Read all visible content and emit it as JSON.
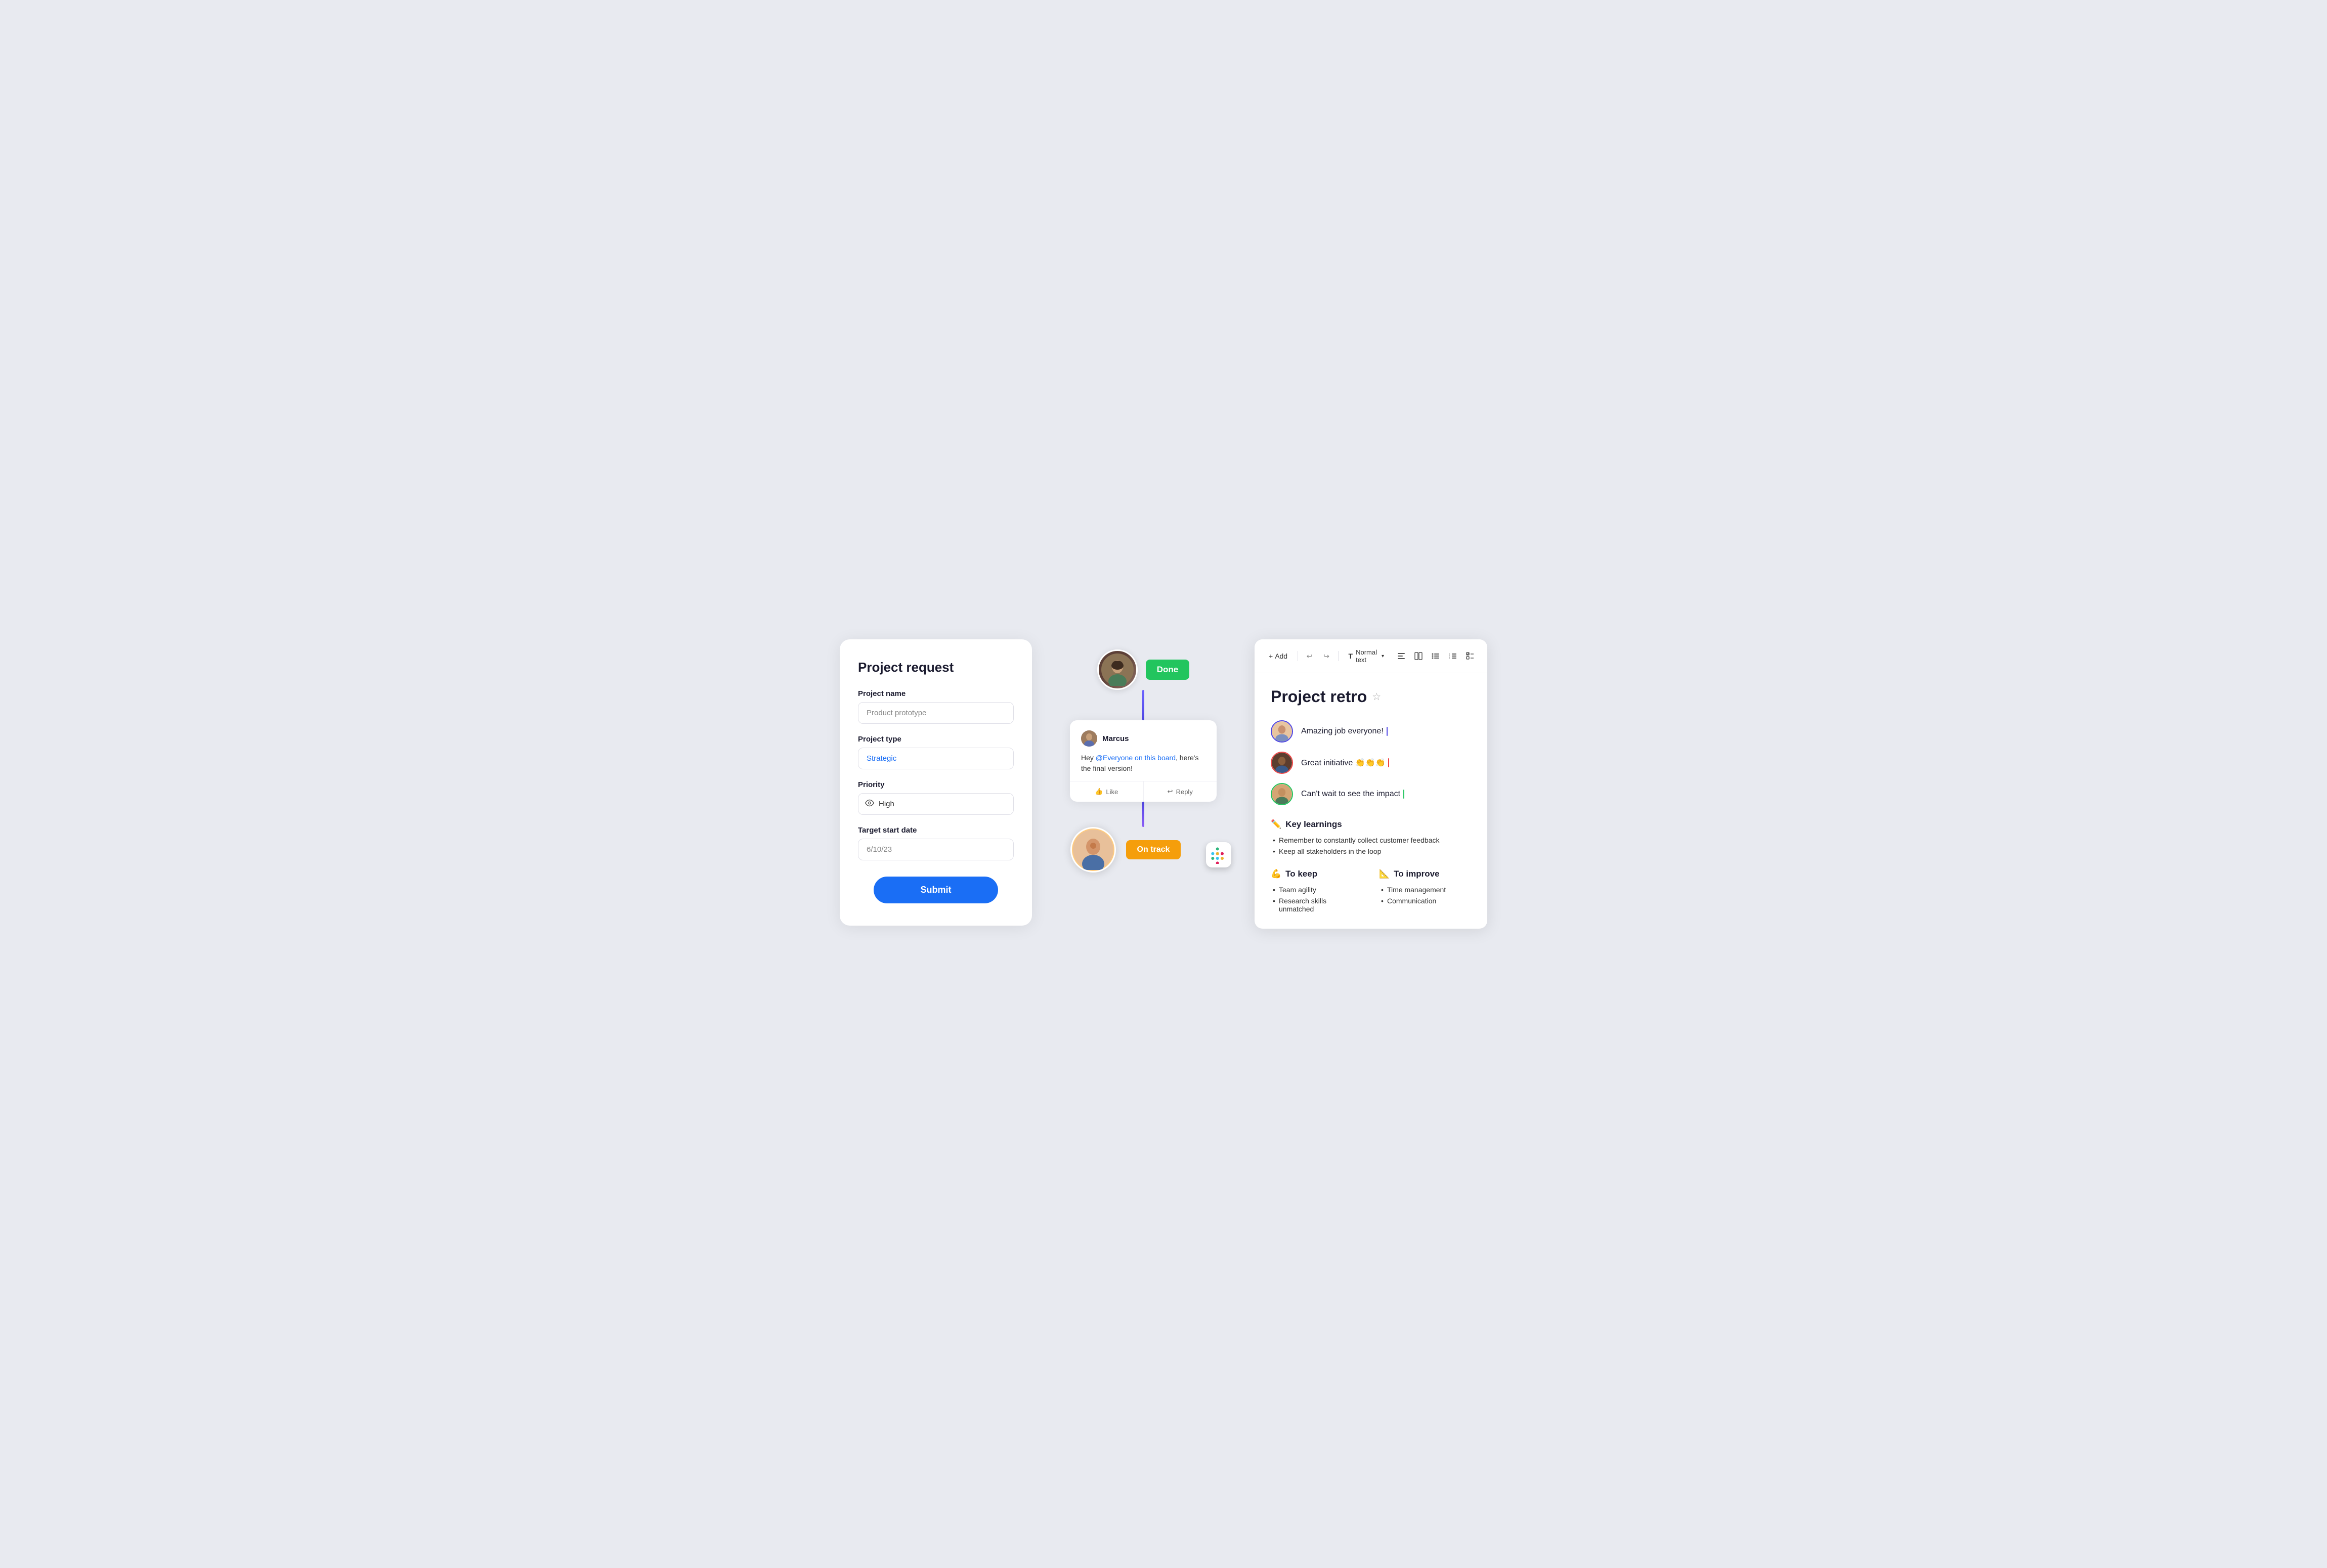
{
  "form": {
    "title": "Project request",
    "project_name_label": "Project name",
    "project_name_value": "Product prototype",
    "project_type_label": "Project type",
    "project_type_value": "Strategic",
    "priority_label": "Priority",
    "priority_value": "High",
    "target_date_label": "Target start date",
    "target_date_value": "6/10/23",
    "submit_label": "Submit"
  },
  "workflow": {
    "done_badge": "Done",
    "on_track_badge": "On track",
    "comment": {
      "author": "Marcus",
      "body_part1": "Hey ",
      "mention": "@Everyone on this board",
      "body_part2": ", here's the final version!",
      "like_label": "Like",
      "reply_label": "Reply"
    }
  },
  "retro": {
    "title": "Project retro",
    "toolbar": {
      "add_label": "+ Add",
      "text_format_label": "Normal text"
    },
    "comments": [
      {
        "text": "Amazing job everyone!",
        "cursor_class": "cursor-blue"
      },
      {
        "text": "Great initiative 👏👏👏",
        "cursor_class": "cursor-red"
      },
      {
        "text": "Can't wait to see the impact",
        "cursor_class": "cursor-green"
      }
    ],
    "key_learnings": {
      "title": "Key learnings",
      "emoji": "✏️",
      "items": [
        "Remember to constantly collect customer feedback",
        "Keep all stakeholders in the loop"
      ]
    },
    "to_keep": {
      "title": "To keep",
      "emoji": "💪",
      "items": [
        "Team agility",
        "Research skills unmatched"
      ]
    },
    "to_improve": {
      "title": "To improve",
      "emoji": "📐",
      "items": [
        "Time management",
        "Communication"
      ]
    }
  }
}
